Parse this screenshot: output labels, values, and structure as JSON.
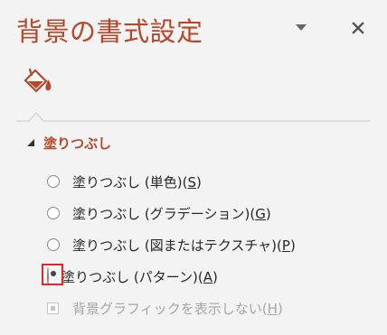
{
  "pane": {
    "title": "背景の書式設定",
    "options_icon": "chevron-down-icon",
    "close_icon": "close-icon"
  },
  "tabs": [
    {
      "name": "fill",
      "icon": "paint-bucket-icon",
      "active": true
    }
  ],
  "section": {
    "label": "塗りつぶし",
    "expanded": true
  },
  "fill_options": [
    {
      "pre": "塗りつぶし (単色)(",
      "key": "S",
      "post": ")",
      "checked": false
    },
    {
      "pre": "塗りつぶし (グラデーション)(",
      "key": "G",
      "post": ")",
      "checked": false
    },
    {
      "pre": "塗りつぶし (図またはテクスチャ)(",
      "key": "P",
      "post": ")",
      "checked": false
    },
    {
      "pre": "塗りつぶし (パターン)(",
      "key": "A",
      "post": ")",
      "checked": true
    }
  ],
  "hide_graphics": {
    "pre": "背景グラフィックを表示しない(",
    "key": "H",
    "post": ")",
    "checked": true,
    "enabled": false
  },
  "colors": {
    "accent": "#b5472b",
    "highlight": "#e0272b",
    "background": "#f3f3f3",
    "disabled_text": "#a6a6a6"
  }
}
